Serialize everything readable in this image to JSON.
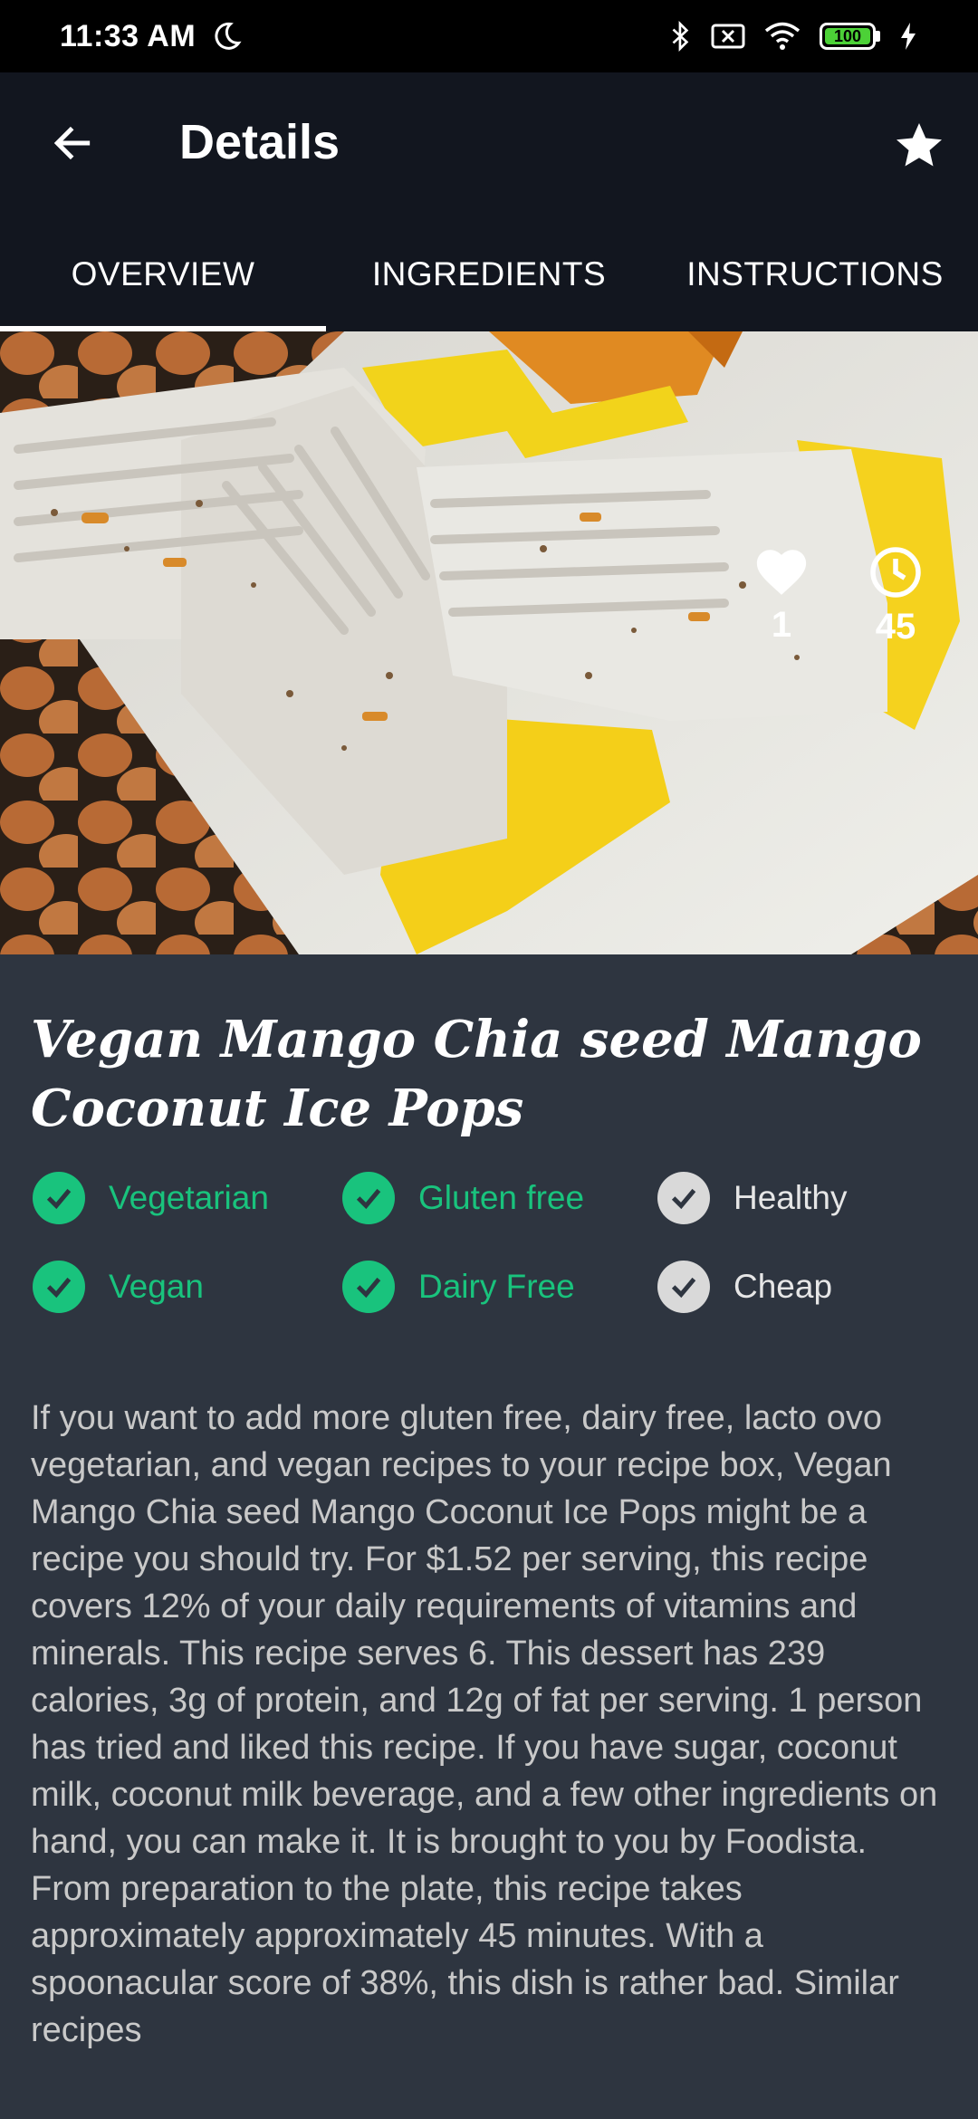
{
  "status_bar": {
    "time": "11:33 AM",
    "battery": "100",
    "icons": [
      "moon-icon",
      "bluetooth-icon",
      "sim-off-icon",
      "wifi-icon",
      "battery-icon",
      "charging-icon"
    ]
  },
  "app_bar": {
    "title": "Details",
    "back_icon": "arrow-left-icon",
    "favorite_icon": "star-icon"
  },
  "tabs": [
    {
      "label": "OVERVIEW",
      "active": true
    },
    {
      "label": "INGREDIENTS",
      "active": false
    },
    {
      "label": "INSTRUCTIONS",
      "active": false
    }
  ],
  "hero": {
    "likes": "1",
    "minutes": "45",
    "like_icon": "heart-icon",
    "time_icon": "clock-icon"
  },
  "recipe": {
    "title": "Vegan Mango Chia seed Mango Coconut Ice Pops",
    "tags": [
      {
        "label": "Vegetarian",
        "active": true
      },
      {
        "label": "Gluten free",
        "active": true
      },
      {
        "label": "Healthy",
        "active": false
      },
      {
        "label": "Vegan",
        "active": true
      },
      {
        "label": "Dairy Free",
        "active": true
      },
      {
        "label": "Cheap",
        "active": false
      }
    ],
    "summary": "If you want to add more gluten free, dairy free, lacto ovo vegetarian, and vegan recipes to your recipe box, Vegan Mango Chia seed Mango Coconut Ice Pops might be a recipe you should try. For $1.52 per serving, this recipe covers 12% of your daily requirements of vitamins and minerals. This recipe serves 6. This dessert has 239 calories, 3g of protein, and 12g of fat per serving. 1 person has tried and liked this recipe. If you have sugar, coconut milk, coconut milk beverage, and a few other ingredients on hand, you can make it. It is brought to you by Foodista. From preparation to the plate, this recipe takes approximately approximately 45 minutes. With a spoonacular score of 38%, this dish is rather bad. Similar recipes"
  },
  "colors": {
    "active_tag": "#19c37d",
    "inactive_tag": "#d9d9d9",
    "app_bar": "#12161f",
    "content_bg": "#2e3540"
  }
}
